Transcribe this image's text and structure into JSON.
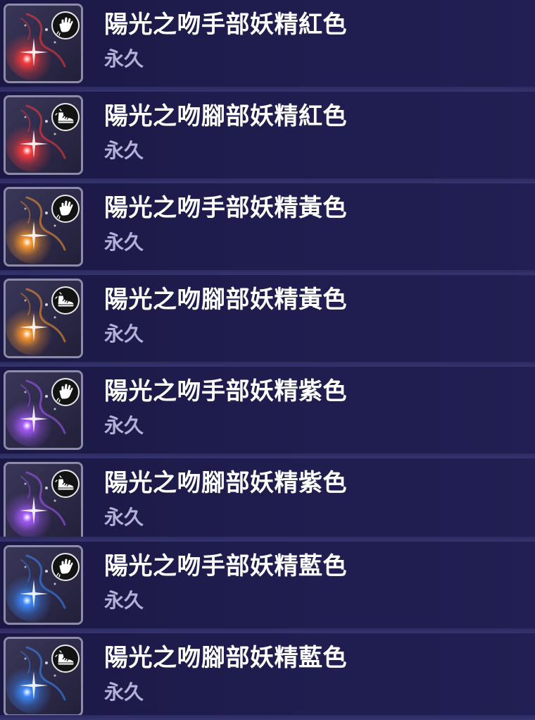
{
  "items": [
    {
      "title": "陽光之吻手部妖精紅色",
      "duration": "永久",
      "slot_icon": "hand-icon",
      "color": "#ff3b3b"
    },
    {
      "title": "陽光之吻腳部妖精紅色",
      "duration": "永久",
      "slot_icon": "shoe-icon",
      "color": "#ff3b3b"
    },
    {
      "title": "陽光之吻手部妖精黃色",
      "duration": "永久",
      "slot_icon": "hand-icon",
      "color": "#ff9a2e"
    },
    {
      "title": "陽光之吻腳部妖精黃色",
      "duration": "永久",
      "slot_icon": "shoe-icon",
      "color": "#ff9a2e"
    },
    {
      "title": "陽光之吻手部妖精紫色",
      "duration": "永久",
      "slot_icon": "hand-icon",
      "color": "#a85cff"
    },
    {
      "title": "陽光之吻腳部妖精紫色",
      "duration": "永久",
      "slot_icon": "shoe-icon",
      "color": "#a85cff"
    },
    {
      "title": "陽光之吻手部妖精藍色",
      "duration": "永久",
      "slot_icon": "hand-icon",
      "color": "#3d8bff"
    },
    {
      "title": "陽光之吻腳部妖精藍色",
      "duration": "永久",
      "slot_icon": "shoe-icon",
      "color": "#3d8bff"
    }
  ]
}
